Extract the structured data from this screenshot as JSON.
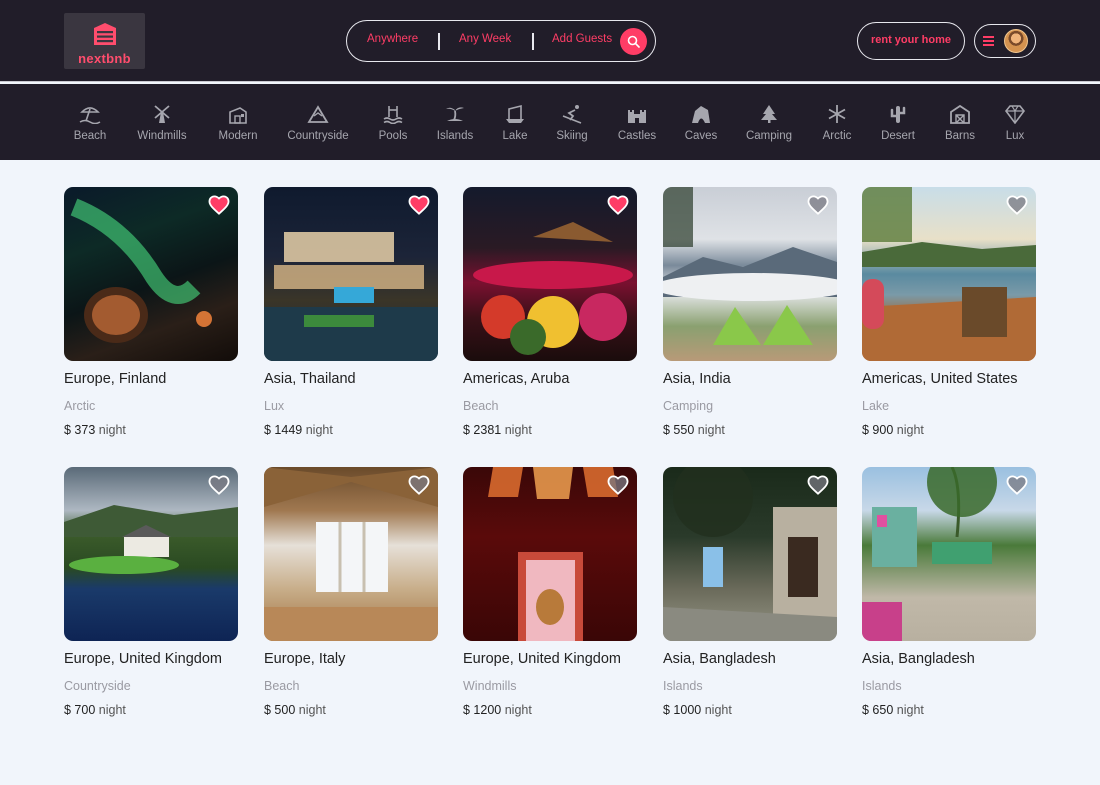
{
  "app": {
    "logo_text": "nextbnb"
  },
  "search": {
    "anywhere": "Anywhere",
    "any_week": "Any Week",
    "add_guests": "Add Guests"
  },
  "header": {
    "rent_label": "rent your home"
  },
  "colors": {
    "accent": "#ff3d66",
    "dark_bar": "#211d29",
    "page_bg": "#f1f5fb"
  },
  "categories": [
    {
      "label": "Beach",
      "icon": "beach-icon"
    },
    {
      "label": "Windmills",
      "icon": "windmill-icon"
    },
    {
      "label": "Modern",
      "icon": "modern-house-icon"
    },
    {
      "label": "Countryside",
      "icon": "mountain-icon"
    },
    {
      "label": "Pools",
      "icon": "pool-icon"
    },
    {
      "label": "Islands",
      "icon": "island-icon"
    },
    {
      "label": "Lake",
      "icon": "boat-icon"
    },
    {
      "label": "Skiing",
      "icon": "skiing-icon"
    },
    {
      "label": "Castles",
      "icon": "castle-icon"
    },
    {
      "label": "Caves",
      "icon": "cave-icon"
    },
    {
      "label": "Camping",
      "icon": "tree-icon"
    },
    {
      "label": "Arctic",
      "icon": "snowflake-icon"
    },
    {
      "label": "Desert",
      "icon": "cactus-icon"
    },
    {
      "label": "Barns",
      "icon": "barn-icon"
    },
    {
      "label": "Lux",
      "icon": "diamond-icon"
    }
  ],
  "listings": [
    {
      "location": "Europe, Finland",
      "category": "Arctic",
      "price": "$ 373",
      "unit": "night",
      "favorited": true
    },
    {
      "location": "Asia, Thailand",
      "category": "Lux",
      "price": "$ 1449",
      "unit": "night",
      "favorited": true
    },
    {
      "location": "Americas, Aruba",
      "category": "Beach",
      "price": "$ 2381",
      "unit": "night",
      "favorited": true
    },
    {
      "location": "Asia, India",
      "category": "Camping",
      "price": "$ 550",
      "unit": "night",
      "favorited": false
    },
    {
      "location": "Americas, United States",
      "category": "Lake",
      "price": "$ 900",
      "unit": "night",
      "favorited": false
    },
    {
      "location": "Europe, United Kingdom",
      "category": "Countryside",
      "price": "$ 700",
      "unit": "night",
      "favorited": false
    },
    {
      "location": "Europe, Italy",
      "category": "Beach",
      "price": "$ 500",
      "unit": "night",
      "favorited": false
    },
    {
      "location": "Europe, United Kingdom",
      "category": "Windmills",
      "price": "$ 1200",
      "unit": "night",
      "favorited": false
    },
    {
      "location": "Asia, Bangladesh",
      "category": "Islands",
      "price": "$ 1000",
      "unit": "night",
      "favorited": false
    },
    {
      "location": "Asia, Bangladesh",
      "category": "Islands",
      "price": "$ 650",
      "unit": "night",
      "favorited": false
    }
  ]
}
